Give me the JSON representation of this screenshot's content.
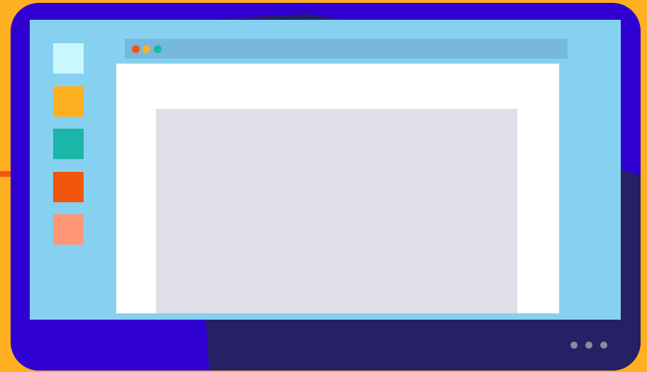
{
  "colors": {
    "background": "#FFB020",
    "accent_stripe": "#F0560E",
    "device_frame": "#2F00D1",
    "device_shadow": "#262066",
    "screen": "#87D1F0",
    "titlebar": "#77B8DE",
    "window": "#FFFFFF",
    "content_block": "#DEDFE7",
    "pager_dot": "#8B8A9E"
  },
  "sidebar": {
    "swatches": [
      {
        "name": "swatch-light-cyan",
        "color": "#C8F8FD"
      },
      {
        "name": "swatch-amber",
        "color": "#FFB020"
      },
      {
        "name": "swatch-teal",
        "color": "#1AB6A8"
      },
      {
        "name": "swatch-orange",
        "color": "#F0560E"
      },
      {
        "name": "swatch-salmon",
        "color": "#FF9777"
      }
    ]
  },
  "window_controls": [
    {
      "name": "close-dot",
      "color": "#F0560E"
    },
    {
      "name": "minimize-dot",
      "color": "#FFB020"
    },
    {
      "name": "maximize-dot",
      "color": "#1AB6A8"
    }
  ],
  "pager": {
    "count": 3
  }
}
